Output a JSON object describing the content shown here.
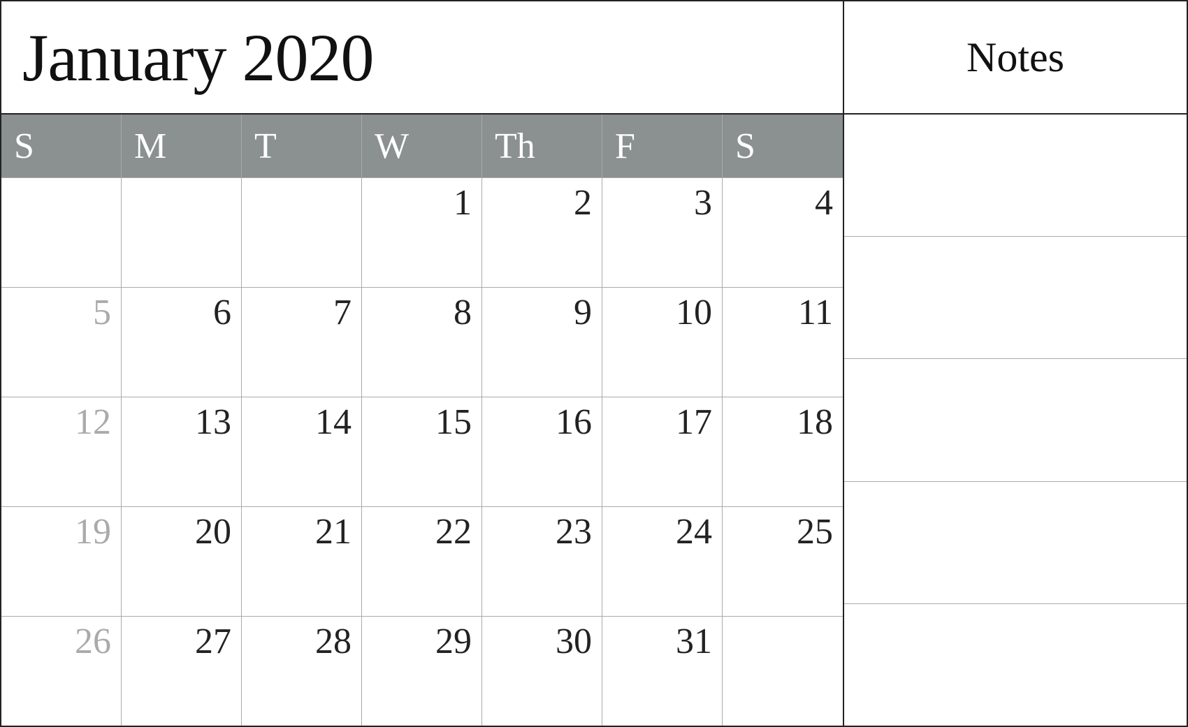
{
  "header": {
    "title": "January 2020",
    "notes_label": "Notes"
  },
  "day_headers": [
    "S",
    "M",
    "T",
    "W",
    "Th",
    "F",
    "S"
  ],
  "weeks": [
    [
      {
        "num": "",
        "type": "empty"
      },
      {
        "num": "",
        "type": "empty"
      },
      {
        "num": "",
        "type": "empty"
      },
      {
        "num": "1",
        "type": "normal"
      },
      {
        "num": "2",
        "type": "normal"
      },
      {
        "num": "3",
        "type": "normal"
      },
      {
        "num": "4",
        "type": "normal"
      }
    ],
    [
      {
        "num": "5",
        "type": "sunday"
      },
      {
        "num": "6",
        "type": "normal"
      },
      {
        "num": "7",
        "type": "normal"
      },
      {
        "num": "8",
        "type": "normal"
      },
      {
        "num": "9",
        "type": "normal"
      },
      {
        "num": "10",
        "type": "normal"
      },
      {
        "num": "11",
        "type": "normal"
      }
    ],
    [
      {
        "num": "12",
        "type": "sunday"
      },
      {
        "num": "13",
        "type": "normal"
      },
      {
        "num": "14",
        "type": "normal"
      },
      {
        "num": "15",
        "type": "normal"
      },
      {
        "num": "16",
        "type": "normal"
      },
      {
        "num": "17",
        "type": "normal"
      },
      {
        "num": "18",
        "type": "normal"
      }
    ],
    [
      {
        "num": "19",
        "type": "sunday"
      },
      {
        "num": "20",
        "type": "normal"
      },
      {
        "num": "21",
        "type": "normal"
      },
      {
        "num": "22",
        "type": "normal"
      },
      {
        "num": "23",
        "type": "normal"
      },
      {
        "num": "24",
        "type": "normal"
      },
      {
        "num": "25",
        "type": "normal"
      }
    ],
    [
      {
        "num": "26",
        "type": "sunday"
      },
      {
        "num": "27",
        "type": "normal"
      },
      {
        "num": "28",
        "type": "normal"
      },
      {
        "num": "29",
        "type": "normal"
      },
      {
        "num": "30",
        "type": "normal"
      },
      {
        "num": "31",
        "type": "normal"
      },
      {
        "num": "",
        "type": "empty"
      }
    ]
  ]
}
